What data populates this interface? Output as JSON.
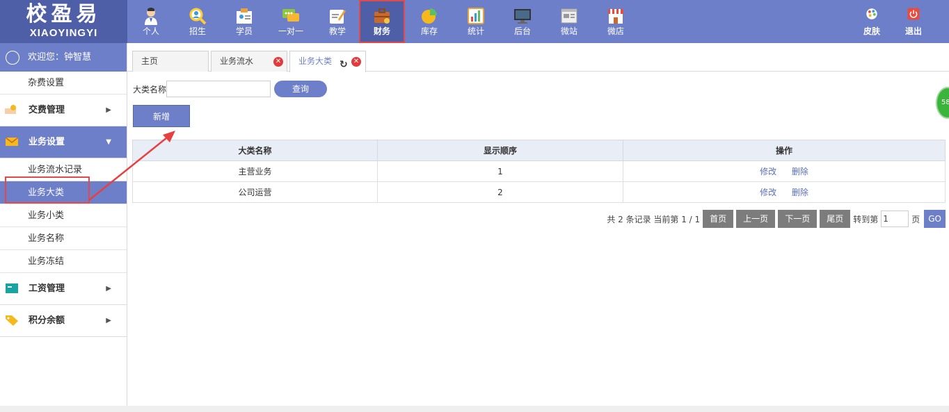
{
  "logo": {
    "title": "校盈易",
    "sub": "XIAOYINGYI"
  },
  "nav": [
    {
      "label": "个人",
      "icon": "person-icon"
    },
    {
      "label": "招生",
      "icon": "recruit-search-icon"
    },
    {
      "label": "学员",
      "icon": "student-icon"
    },
    {
      "label": "一对一",
      "icon": "chat-icon"
    },
    {
      "label": "教学",
      "icon": "teaching-icon"
    },
    {
      "label": "财务",
      "icon": "briefcase-icon"
    },
    {
      "label": "库存",
      "icon": "inventory-pie-icon"
    },
    {
      "label": "统计",
      "icon": "stats-icon"
    },
    {
      "label": "后台",
      "icon": "monitor-icon"
    },
    {
      "label": "微站",
      "icon": "micro-site-icon"
    },
    {
      "label": "微店",
      "icon": "shop-icon"
    }
  ],
  "nav_right": [
    {
      "label": "皮肤",
      "icon": "palette-icon"
    },
    {
      "label": "退出",
      "icon": "power-icon"
    }
  ],
  "sidebar": {
    "welcome": "欢迎您：钟智慧",
    "top_item": "杂费设置",
    "groups": [
      {
        "label": "交费管理",
        "icon": "payment-icon"
      },
      {
        "label": "业务设置",
        "icon": "mail-icon"
      },
      {
        "label": "工资管理",
        "icon": "salary-icon"
      },
      {
        "label": "积分余额",
        "icon": "tag-icon"
      }
    ],
    "business_items": [
      "业务流水记录",
      "业务大类",
      "业务小类",
      "业务名称",
      "业务冻结"
    ]
  },
  "tabs": [
    {
      "label": "主页"
    },
    {
      "label": "业务流水"
    },
    {
      "label": "业务大类"
    }
  ],
  "filter": {
    "label": "大类名称",
    "value": "",
    "query_button": "查询"
  },
  "add_button": "新增",
  "table": {
    "headers": [
      "大类名称",
      "显示顺序",
      "操作"
    ],
    "rows": [
      {
        "name": "主营业务",
        "order": "1"
      },
      {
        "name": "公司运营",
        "order": "2"
      }
    ],
    "actions": {
      "edit": "修改",
      "delete": "删除"
    }
  },
  "pager": {
    "summary": "共 2 条记录 当前第 1 / 1",
    "first": "首页",
    "prev": "上一页",
    "next": "下一页",
    "last": "尾页",
    "goto_label": "转到第",
    "page_value": "1",
    "page_suffix": "页",
    "go": "GO"
  },
  "side_badge": "58",
  "colors": {
    "primary": "#6e7fca",
    "logo_bg": "#4e5fa8",
    "highlight": "#e04a4a"
  }
}
